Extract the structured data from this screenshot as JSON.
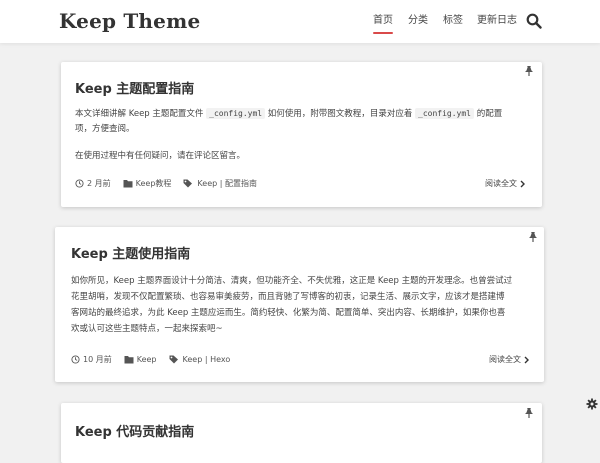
{
  "header": {
    "logo": "Keep Theme",
    "nav": [
      {
        "label": "首页",
        "active": true
      },
      {
        "label": "分类",
        "active": false
      },
      {
        "label": "标签",
        "active": false
      },
      {
        "label": "更新日志",
        "active": false
      }
    ],
    "search_icon": "search-icon",
    "accent_color": "#d94a4a"
  },
  "posts": [
    {
      "title": "Keep 主题配置指南",
      "excerpt_line1_a": "本文详细讲解 Keep 主题配置文件 ",
      "excerpt_code1": "_config.yml",
      "excerpt_line1_b": " 如何使用，附带图文教程，目录对应着 ",
      "excerpt_code2": "_config.yml",
      "excerpt_line1_c": " 的配置",
      "excerpt_line2": "项，方便查阅。",
      "excerpt_para2": "在使用过程中有任何疑问，请在评论区留言。",
      "time": "2 月前",
      "category": "Keep教程",
      "tags": "Keep | 配置指南",
      "read_more": "阅读全文"
    },
    {
      "title": "Keep 主题使用指南",
      "excerpt_lines": [
        "如你所见，Keep 主题界面设计十分简洁、清爽，但功能齐全、不失优雅，这正是 Keep 主题的开发理念。也曾尝试过",
        "花里胡哨，发现不仅配置繁琐、也容易审美疲劳，而且背驰了写博客的初衷，记录生活、展示文字，应该才是搭建博",
        "客网站的最终追求，为此 Keep 主题应运而生。简约轻快、化繁为简、配置简单、突出内容、长期维护，如果你也喜",
        "欢或认可这些主题特点，一起来探索吧~"
      ],
      "time": "10 月前",
      "category": "Keep",
      "tags": "Keep | Hexo",
      "read_more": "阅读全文"
    },
    {
      "title": "Keep 代码贡献指南"
    }
  ],
  "icons": {
    "pin": "pin-icon",
    "clock": "clock-icon",
    "folder": "folder-icon",
    "tag": "tag-icon",
    "chevron": "chevron-right-icon",
    "gear": "gear-icon"
  }
}
